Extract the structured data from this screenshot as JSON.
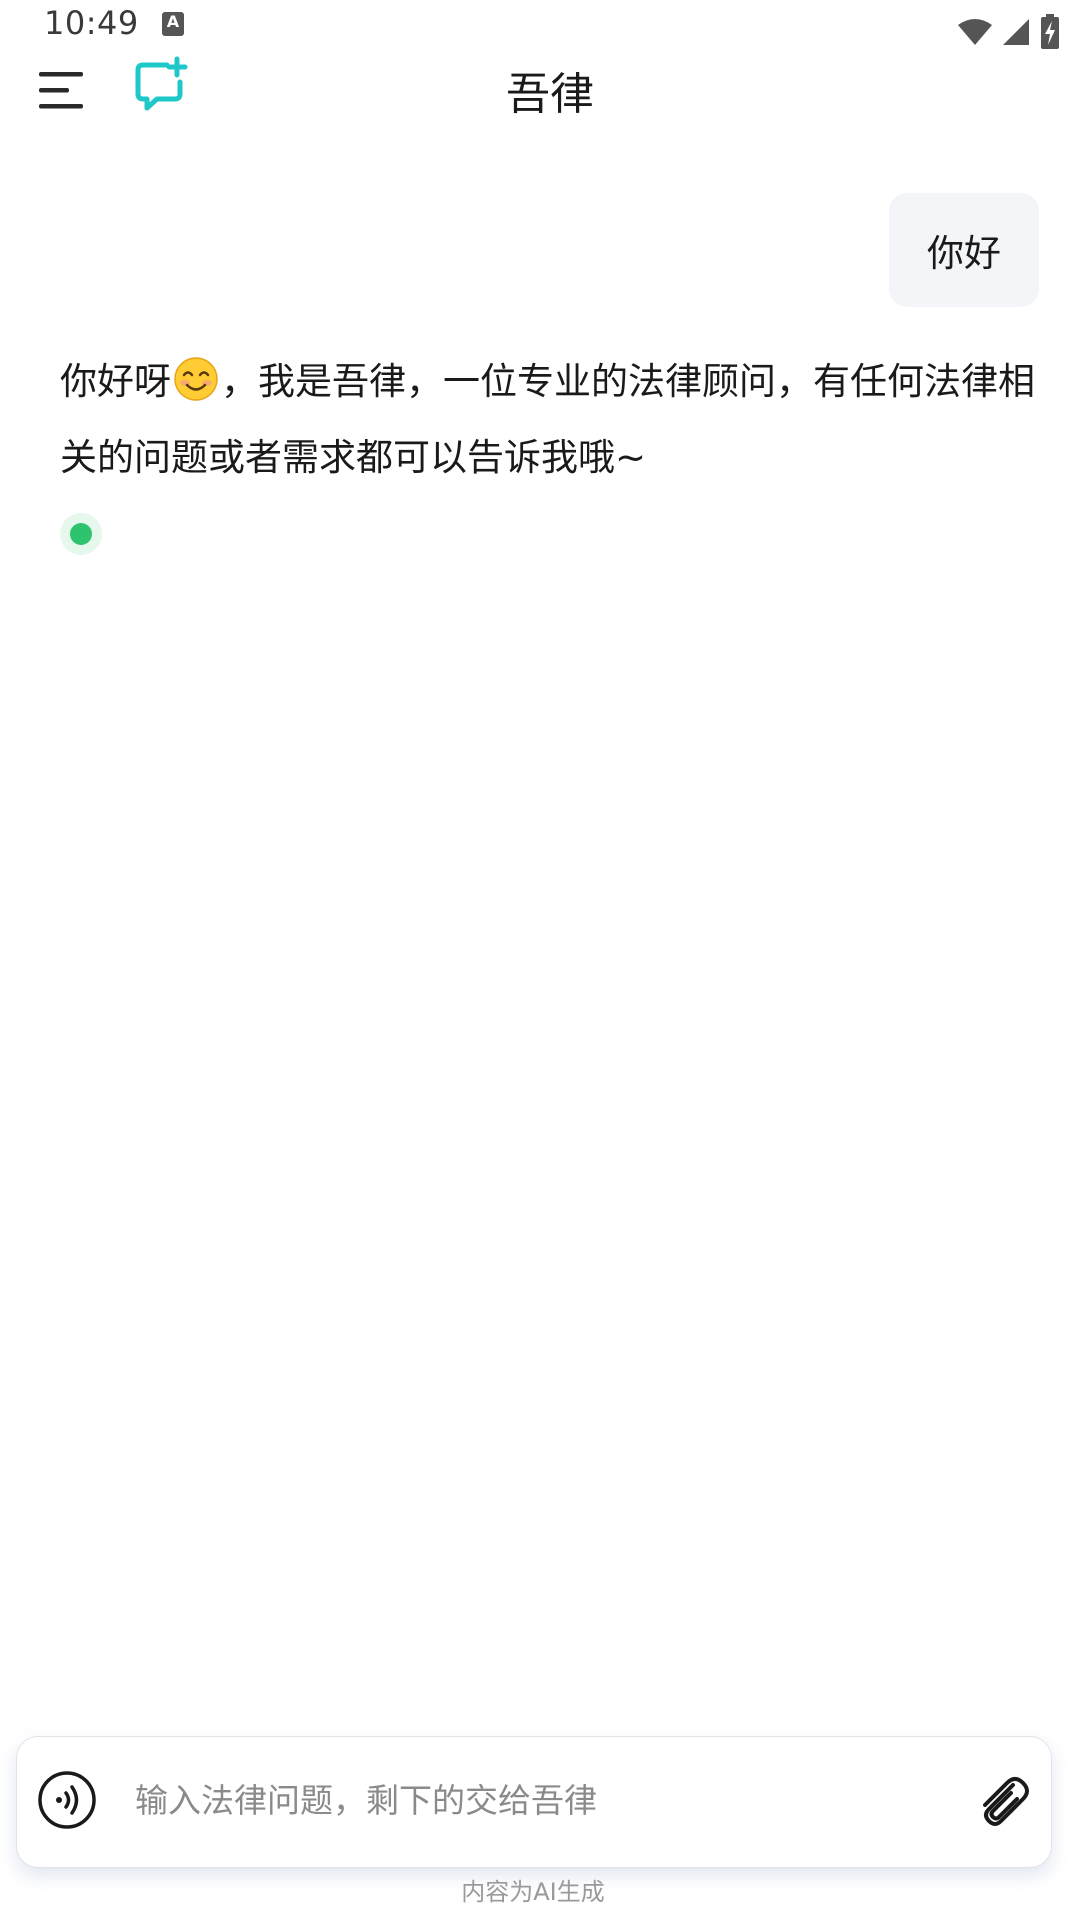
{
  "status_bar": {
    "time": "10:49",
    "notification_icon_letter": "A",
    "icons": [
      "wifi-icon",
      "signal-icon",
      "battery-charging-icon"
    ]
  },
  "header": {
    "title": "吾律",
    "menu_icon": "hamburger-menu-icon",
    "new_chat_icon": "new-chat-icon",
    "accent_color": "#1ec8c8"
  },
  "conversation": {
    "user_message": "你好",
    "assistant_message_part1": "你好呀",
    "assistant_emoji": "smiling-face-emoji",
    "assistant_message_part2": "，我是吾律，一位专业的法律顾问，有任何法律相关的问题或者需求都可以告诉我哦~",
    "status_indicator_color": "#2ec46e"
  },
  "input_bar": {
    "placeholder": "输入法律问题，剩下的交给吾律",
    "value": "",
    "voice_icon": "voice-input-icon",
    "attach_icon": "paperclip-icon"
  },
  "footer": {
    "note": "内容为AI生成"
  }
}
